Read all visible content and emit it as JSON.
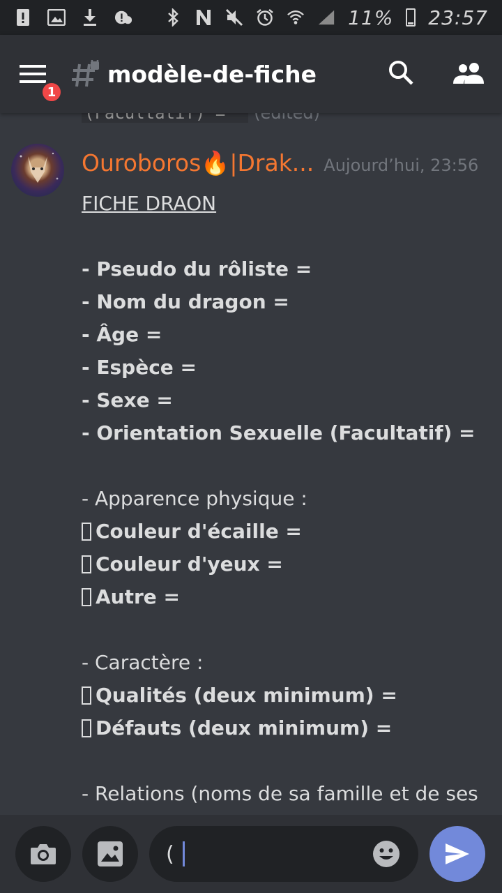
{
  "status_bar": {
    "battery_text": "11%",
    "time": "23:57"
  },
  "header": {
    "channel_name": "modèle-de-fiche",
    "notification_count": "1"
  },
  "previous_message": {
    "text": "(Facultatif) =^^",
    "edited": "(edited)"
  },
  "message": {
    "author": "Ouroboros🔥|Drak...",
    "timestamp": "Aujourd’hui, 23:56",
    "title": "FICHE DRAON",
    "lines": {
      "l1": "- Pseudo du rôliste =",
      "l2": "- Nom du dragon =",
      "l3": "- Âge =",
      "l4": "- Espèce =",
      "l5": "- Sexe =",
      "l6": "- Orientation Sexuelle (Facultatif) =",
      "l7": "- Apparence physique :",
      "l8": "Couleur d'écaille =",
      "l9": "Couleur d'yeux =",
      "l10": "Autre =",
      "l11": "- Caractère :",
      "l12": "Qualités (deux minimum) =",
      "l13": "Défauts (deux minimum) =",
      "l14": "- Relations (noms de sa famille et de ses"
    }
  },
  "composer": {
    "input_value": "("
  },
  "colors": {
    "background": "#36393f",
    "header": "#2f3136",
    "accent": "#7289da",
    "author": "#f57731",
    "badge": "#f04747"
  }
}
